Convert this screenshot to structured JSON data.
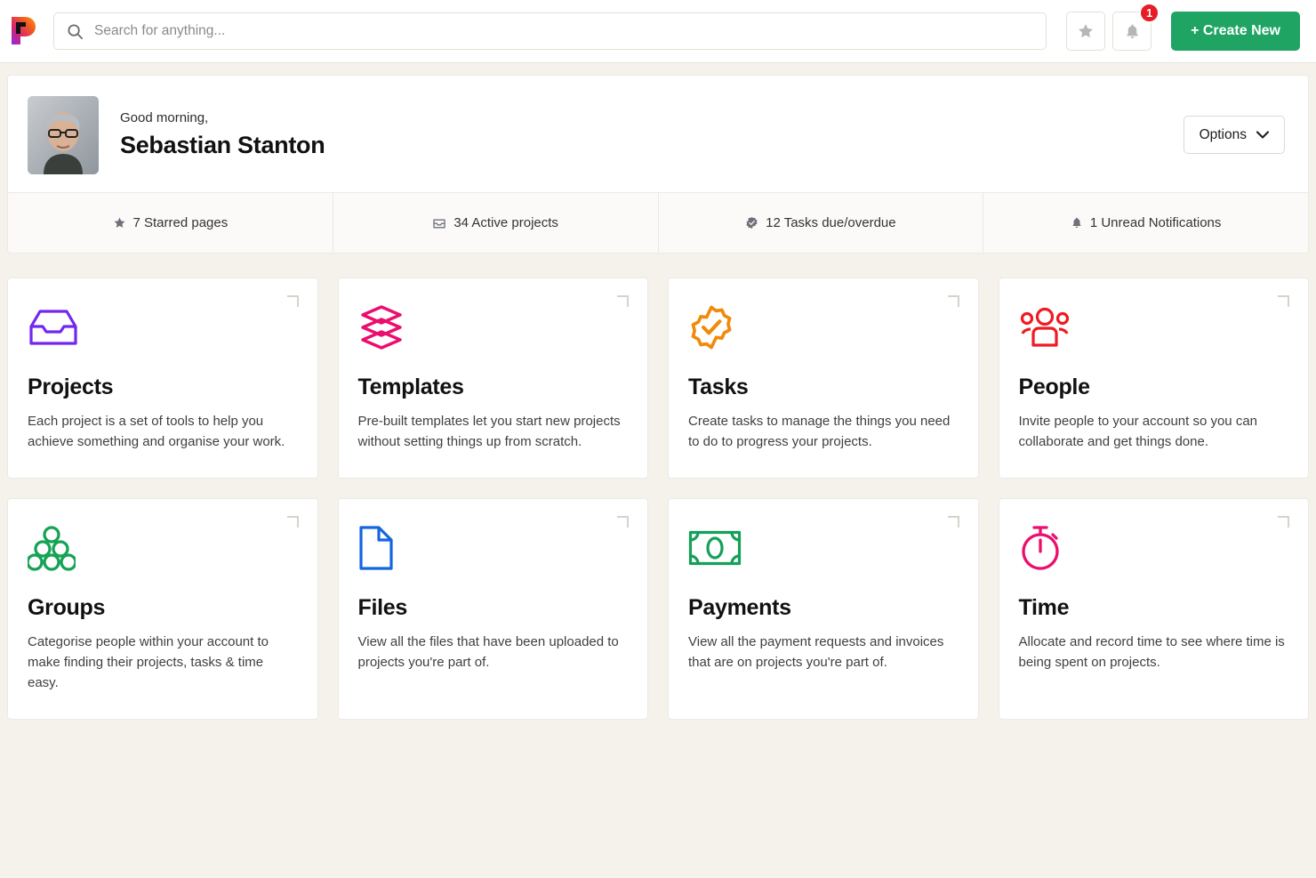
{
  "header": {
    "logo_icon": "pi-logo-icon",
    "search": {
      "icon": "search-icon",
      "value": "",
      "placeholder": "Search for anything..."
    },
    "star_button": {
      "icon": "star-icon",
      "label": ""
    },
    "notifications_button": {
      "icon": "bell-icon",
      "badge": "1"
    },
    "create_button": {
      "label": "+ Create New",
      "color": "#1fa463"
    }
  },
  "profile": {
    "avatar_icon": "user-avatar-photo",
    "greeting": "Good morning,",
    "name": "Sebastian Stanton",
    "options_button": {
      "label": "Options",
      "icon": "chevron-down-icon"
    }
  },
  "stats": [
    {
      "icon": "star-icon",
      "label": "7 Starred pages",
      "count": "7"
    },
    {
      "icon": "inbox-icon",
      "label": "34 Active projects",
      "count": "34"
    },
    {
      "icon": "check-badge-icon",
      "label": "12 Tasks due/overdue",
      "count": "12"
    },
    {
      "icon": "bell-icon",
      "label": "1 Unread Notifications",
      "count": "1"
    }
  ],
  "cards": [
    {
      "icon": "inbox-tray-icon",
      "color": "#7226f0",
      "title": "Projects",
      "desc": "Each project is a set of tools to help you achieve something and organise your work."
    },
    {
      "icon": "layers-stack-icon",
      "color": "#ec0e6e",
      "title": "Templates",
      "desc": "Pre-built templates let you start new projects without setting things up from scratch."
    },
    {
      "icon": "check-badge-icon",
      "color": "#f18a0a",
      "title": "Tasks",
      "desc": "Create tasks to manage the things you need to do to progress your projects."
    },
    {
      "icon": "people-group-icon",
      "color": "#ee1b22",
      "title": "People",
      "desc": "Invite people to your account so you can collaborate and get things done."
    },
    {
      "icon": "circles-pyramid-icon",
      "color": "#16a355",
      "title": "Groups",
      "desc": "Categorise people within your account to make finding their projects, tasks & time easy."
    },
    {
      "icon": "document-icon",
      "color": "#1466e0",
      "title": "Files",
      "desc": "View all the files that have been uploaded to projects you're part of."
    },
    {
      "icon": "banknote-icon",
      "color": "#14a05a",
      "title": "Payments",
      "desc": "View all the payment requests and invoices that are on projects you're part of."
    },
    {
      "icon": "stopwatch-icon",
      "color": "#ec0e6e",
      "title": "Time",
      "desc": "Allocate and record time to see where time is being spent on projects."
    }
  ]
}
